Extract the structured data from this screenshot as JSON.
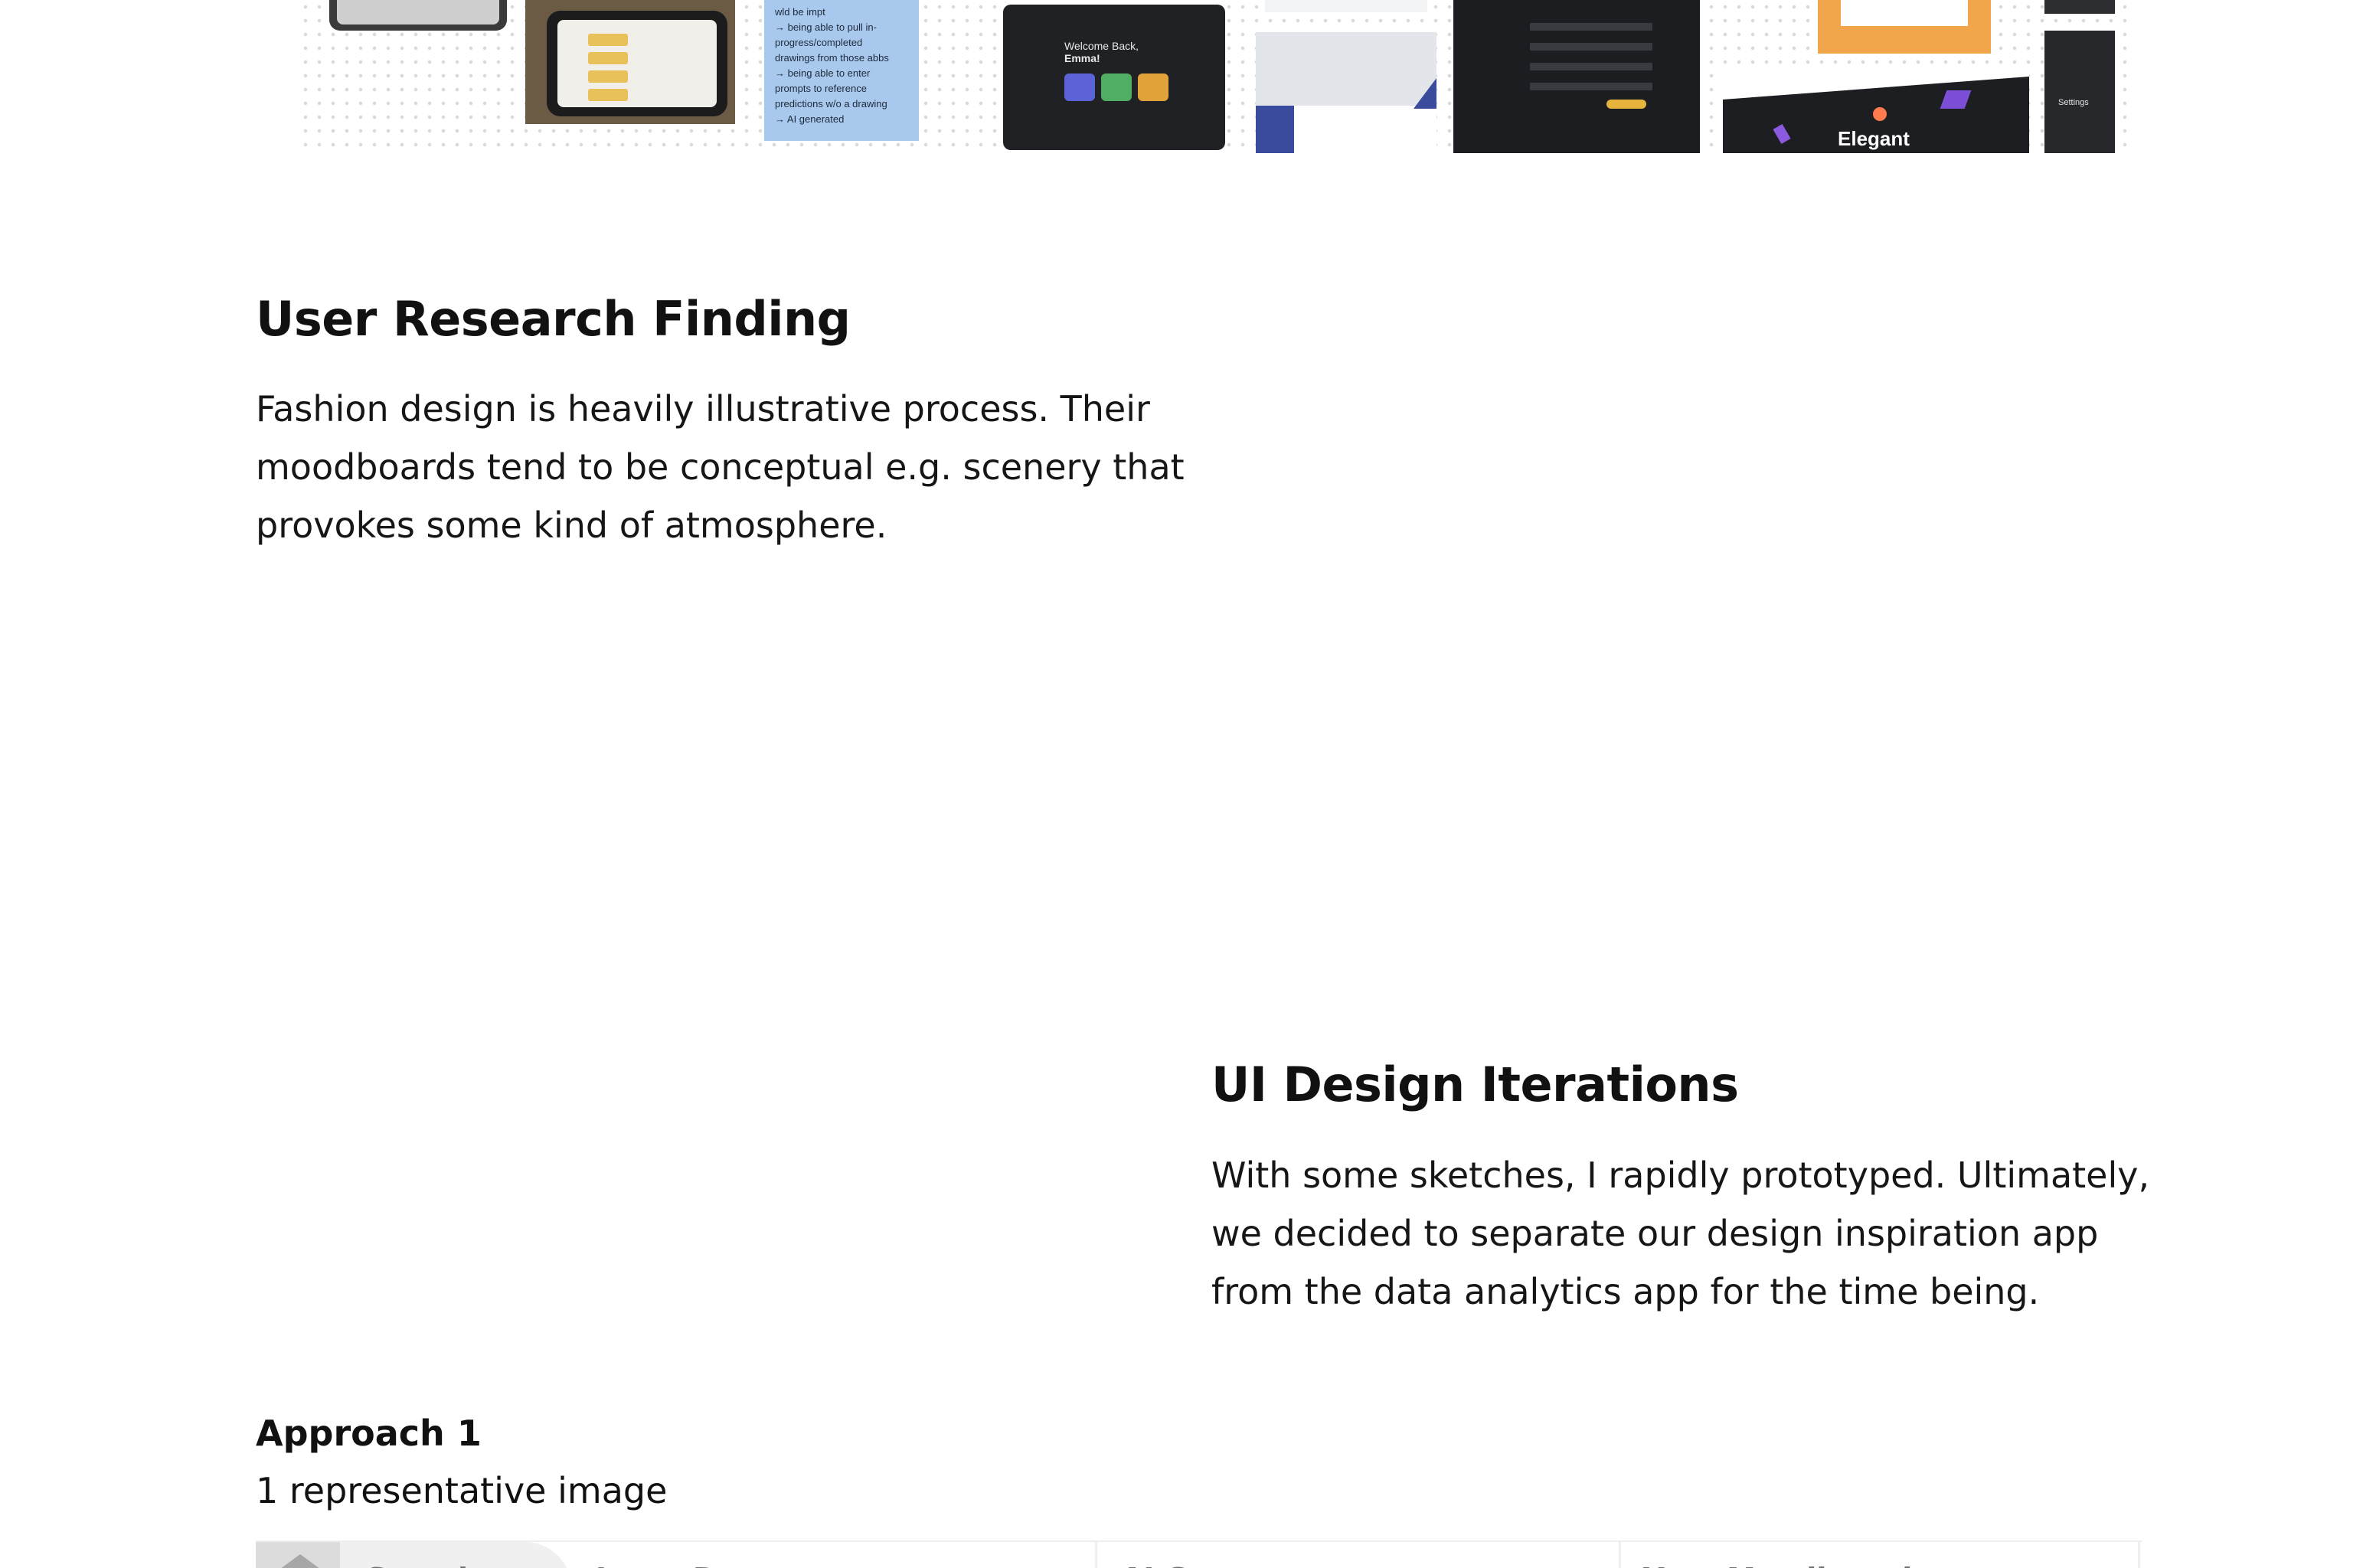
{
  "collage": {
    "sticky_note_lines": [
      "wld be impt",
      "→ being able to pull in-",
      "progress/completed",
      "drawings from those abbs",
      "→ being able to enter",
      "prompts to reference",
      "predictions w/o a drawing",
      "→ AI generated"
    ],
    "dashboard_welcome": [
      "Welcome Back,",
      "Emma!"
    ],
    "elegant_label": "Elegant",
    "settings_label": "Settings"
  },
  "research": {
    "title": "User Research Finding",
    "body": "Fashion design is heavily illustrative process. Their moodboards tend to be conceptual e.g. scenery that provokes some kind of atmosphere."
  },
  "ui_design": {
    "title": "UI Design Iterations",
    "body": "With some sketches, I rapidly prototyped. Ultimately, we decided to separate our design inspiration app from the data analytics app for the time being."
  },
  "approach": {
    "title": "Approach 1",
    "subtitle": "1 representative image"
  },
  "preview_nav": {
    "search": "Search",
    "input_data": "Input Data",
    "ai_generate": "AI Generate",
    "moodboard": "Your Moodboard",
    "more": "•••"
  },
  "colors": {
    "sticky_note": "#a9c8ee",
    "dark_ui": "#1f2125",
    "accent_orange": "#f1a64c",
    "accent_yellow": "#e7b53c"
  }
}
